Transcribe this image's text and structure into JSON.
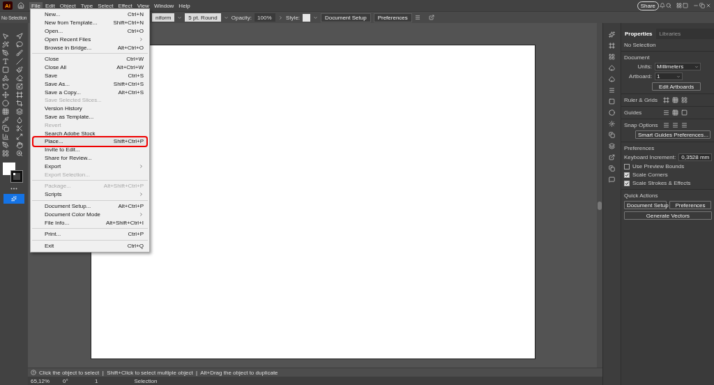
{
  "app": {
    "logo": "Ai"
  },
  "menu_bar": [
    {
      "label": "File",
      "selected": true
    },
    {
      "label": "Edit",
      "selected": false
    },
    {
      "label": "Object",
      "selected": false
    },
    {
      "label": "Type",
      "selected": false
    },
    {
      "label": "Select",
      "selected": false
    },
    {
      "label": "Effect",
      "selected": false
    },
    {
      "label": "View",
      "selected": false
    },
    {
      "label": "Window",
      "selected": false
    },
    {
      "label": "Help",
      "selected": false
    }
  ],
  "share_button": "Share",
  "control_bar": {
    "selection": "No Selection",
    "profile": "niform",
    "brush": "5 pt. Round",
    "opacity_label": "Opacity:",
    "opacity": "100%",
    "style_label": "Style:",
    "buttons": [
      "Document Setup",
      "Preferences"
    ]
  },
  "file_menu": [
    {
      "kind": "item",
      "label": "New...",
      "shortcut": "Ctrl+N",
      "disabled": false,
      "submenu": false,
      "highlighted": false
    },
    {
      "kind": "item",
      "label": "New from Template...",
      "shortcut": "Shift+Ctrl+N",
      "disabled": false,
      "submenu": false,
      "highlighted": false
    },
    {
      "kind": "item",
      "label": "Open...",
      "shortcut": "Ctrl+O",
      "disabled": false,
      "submenu": false,
      "highlighted": false
    },
    {
      "kind": "item",
      "label": "Open Recent Files",
      "disabled": false,
      "submenu": true,
      "highlighted": false
    },
    {
      "kind": "item",
      "label": "Browse in Bridge...",
      "shortcut": "Alt+Ctrl+O",
      "disabled": false,
      "submenu": false,
      "highlighted": false
    },
    {
      "kind": "separator"
    },
    {
      "kind": "item",
      "label": "Close",
      "shortcut": "Ctrl+W",
      "disabled": false,
      "submenu": false,
      "highlighted": false
    },
    {
      "kind": "item",
      "label": "Close All",
      "shortcut": "Alt+Ctrl+W",
      "disabled": false,
      "submenu": false,
      "highlighted": false
    },
    {
      "kind": "item",
      "label": "Save",
      "shortcut": "Ctrl+S",
      "disabled": false,
      "submenu": false,
      "highlighted": false
    },
    {
      "kind": "item",
      "label": "Save As...",
      "shortcut": "Shift+Ctrl+S",
      "disabled": false,
      "submenu": false,
      "highlighted": false
    },
    {
      "kind": "item",
      "label": "Save a Copy...",
      "shortcut": "Alt+Ctrl+S",
      "disabled": false,
      "submenu": false,
      "highlighted": false
    },
    {
      "kind": "item",
      "label": "Save Selected Slices...",
      "disabled": true,
      "submenu": false,
      "highlighted": false
    },
    {
      "kind": "item",
      "label": "Version History",
      "disabled": false,
      "submenu": false,
      "highlighted": false
    },
    {
      "kind": "item",
      "label": "Save as Template...",
      "disabled": false,
      "submenu": false,
      "highlighted": false
    },
    {
      "kind": "item",
      "label": "Revert",
      "disabled": true,
      "submenu": false,
      "highlighted": false
    },
    {
      "kind": "item",
      "label": "Search Adobe Stock",
      "disabled": false,
      "submenu": false,
      "highlighted": false
    },
    {
      "kind": "item",
      "label": "Place...",
      "shortcut": "Shift+Ctrl+P",
      "disabled": false,
      "submenu": false,
      "highlighted": true
    },
    {
      "kind": "item",
      "label": "Invite to Edit...",
      "disabled": false,
      "submenu": false,
      "highlighted": false
    },
    {
      "kind": "item",
      "label": "Share for Review...",
      "disabled": false,
      "submenu": false,
      "highlighted": false
    },
    {
      "kind": "item",
      "label": "Export",
      "disabled": false,
      "submenu": true,
      "highlighted": false
    },
    {
      "kind": "item",
      "label": "Export Selection...",
      "disabled": true,
      "submenu": false,
      "highlighted": false
    },
    {
      "kind": "separator"
    },
    {
      "kind": "item",
      "label": "Package...",
      "shortcut": "Alt+Shift+Ctrl+P",
      "disabled": true,
      "submenu": false,
      "highlighted": false
    },
    {
      "kind": "item",
      "label": "Scripts",
      "disabled": false,
      "submenu": true,
      "highlighted": false
    },
    {
      "kind": "separator"
    },
    {
      "kind": "item",
      "label": "Document Setup...",
      "shortcut": "Alt+Ctrl+P",
      "disabled": false,
      "submenu": false,
      "highlighted": false
    },
    {
      "kind": "item",
      "label": "Document Color Mode",
      "disabled": false,
      "submenu": true,
      "highlighted": false
    },
    {
      "kind": "item",
      "label": "File Info...",
      "shortcut": "Alt+Shift+Ctrl+I",
      "disabled": false,
      "submenu": false,
      "highlighted": false
    },
    {
      "kind": "separator"
    },
    {
      "kind": "item",
      "label": "Print...",
      "shortcut": "Ctrl+P",
      "disabled": false,
      "submenu": false,
      "highlighted": false
    },
    {
      "kind": "separator"
    },
    {
      "kind": "item",
      "label": "Exit",
      "shortcut": "Ctrl+Q",
      "disabled": false,
      "submenu": false,
      "highlighted": false
    }
  ],
  "panel": {
    "tabs": [
      {
        "label": "Properties",
        "selected": true
      },
      {
        "label": "Libraries",
        "selected": false
      }
    ],
    "selection": "No Selection",
    "document": {
      "title": "Document",
      "units_label": "Units:",
      "units": "Millimeters",
      "artboard_label": "Artboard:",
      "artboard": "1",
      "edit_button": "Edit Artboards"
    },
    "ruler_label": "Ruler & Grids",
    "guides_label": "Guides",
    "snap_label": "Snap Options",
    "smart_guides_button": "Smart Guides Preferences...",
    "preferences": {
      "title": "Preferences",
      "increment_label": "Keyboard Increment:",
      "increment": "0,3528 mm",
      "checkboxes": [
        {
          "label": "Use Preview Bounds",
          "checked": false
        },
        {
          "label": "Scale Corners",
          "checked": true
        },
        {
          "label": "Scale Strokes & Effects",
          "checked": true
        }
      ]
    },
    "quick_actions": {
      "title": "Quick Actions",
      "buttons": [
        "Document Setup",
        "Preferences",
        "Generate Vectors"
      ]
    }
  },
  "hint": "Click the object to select  |  Shift+Click to select multiple object  |  Alt+Drag the object to duplicate",
  "status_bar": {
    "zoom": "65,12%",
    "rotation": "0°",
    "artboard": "1",
    "tool": "Selection"
  }
}
